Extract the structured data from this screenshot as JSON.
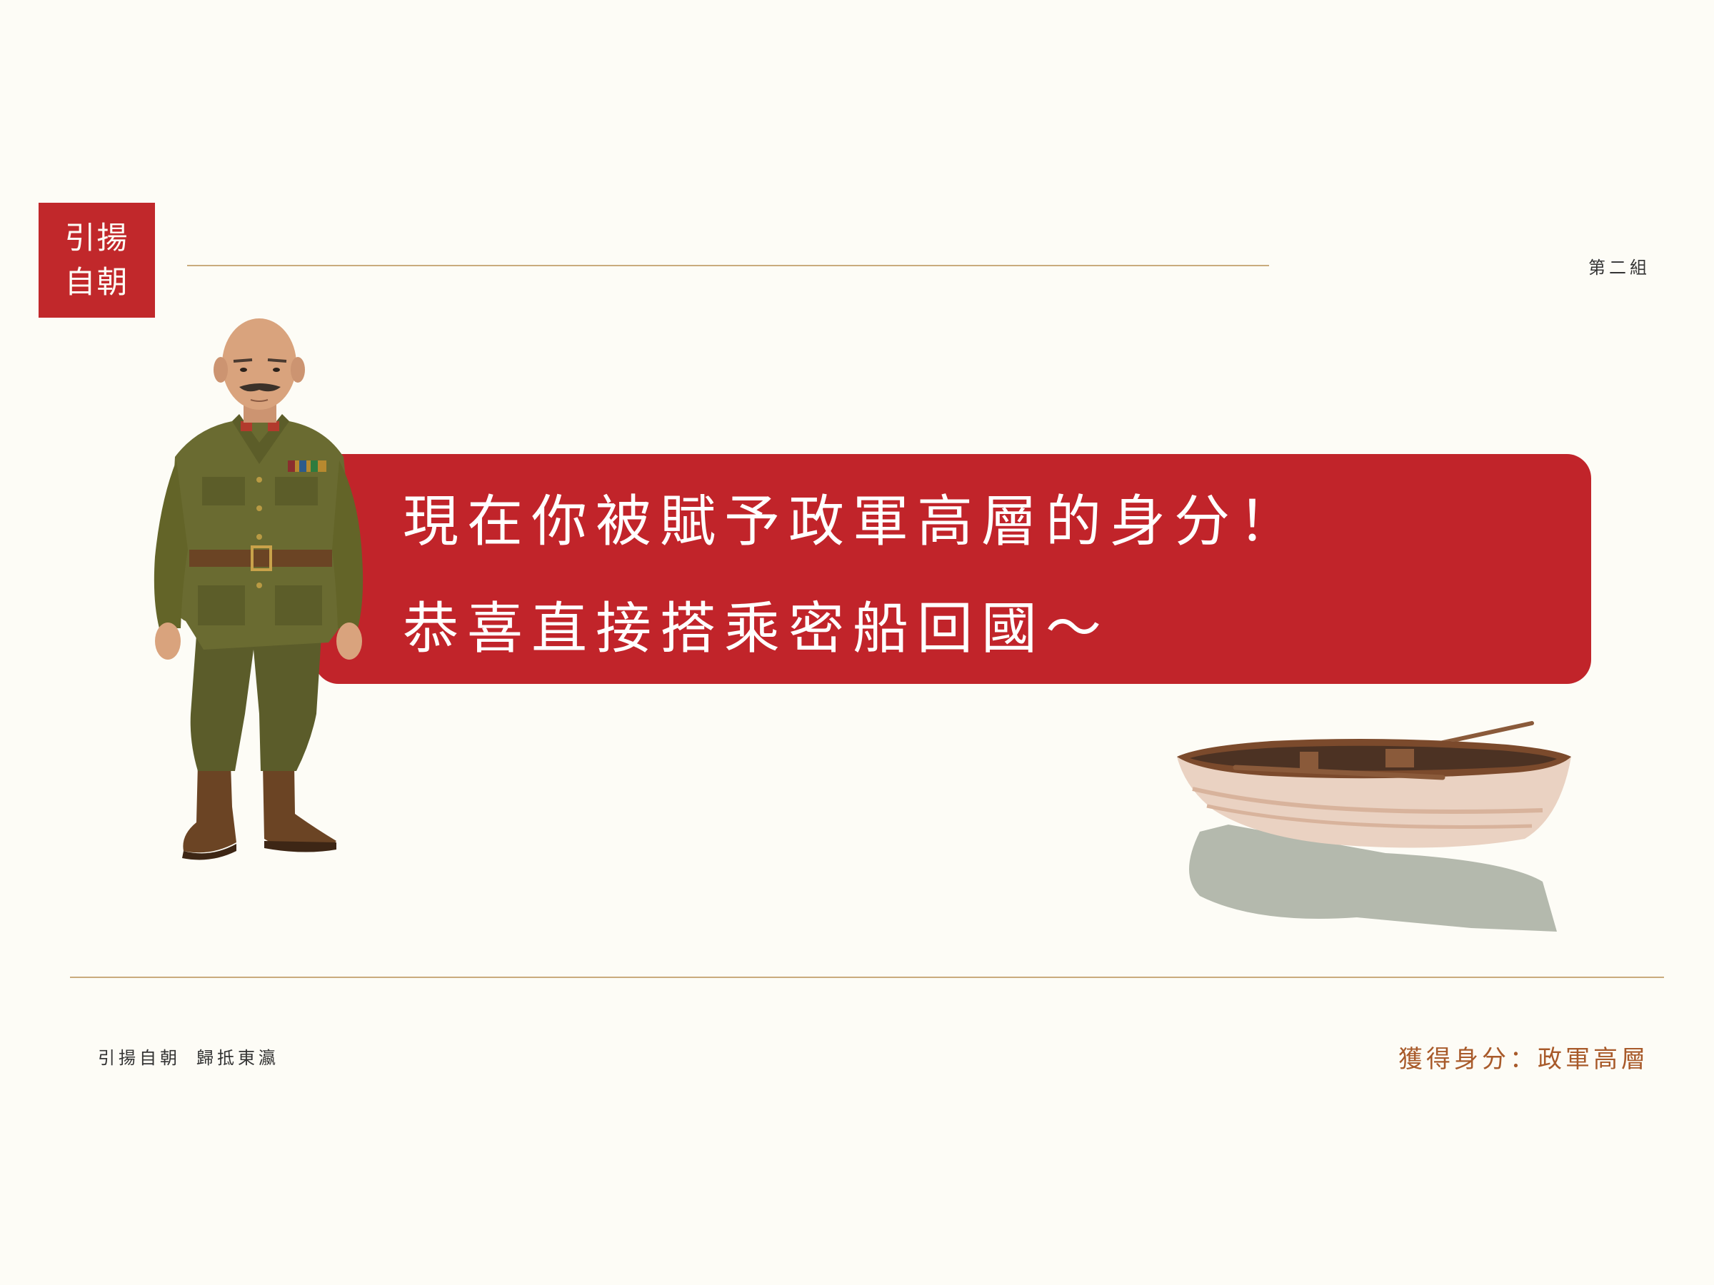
{
  "logo": {
    "line1": "引揚",
    "line2": "自朝"
  },
  "header": {
    "group": "第二組"
  },
  "banner": {
    "line1": "現在你被賦予政軍高層的身分！",
    "line2": "恭喜直接搭乘密船回國～"
  },
  "footer": {
    "title_part1": "引揚自朝",
    "title_part2": "歸抵東瀛",
    "identity_label": "獲得身分：政軍高層"
  },
  "colors": {
    "accent_red": "#c1242a",
    "background": "#fdfcf6",
    "rule_gold": "#c9ab7d",
    "identity_brown": "#a85a2a"
  }
}
